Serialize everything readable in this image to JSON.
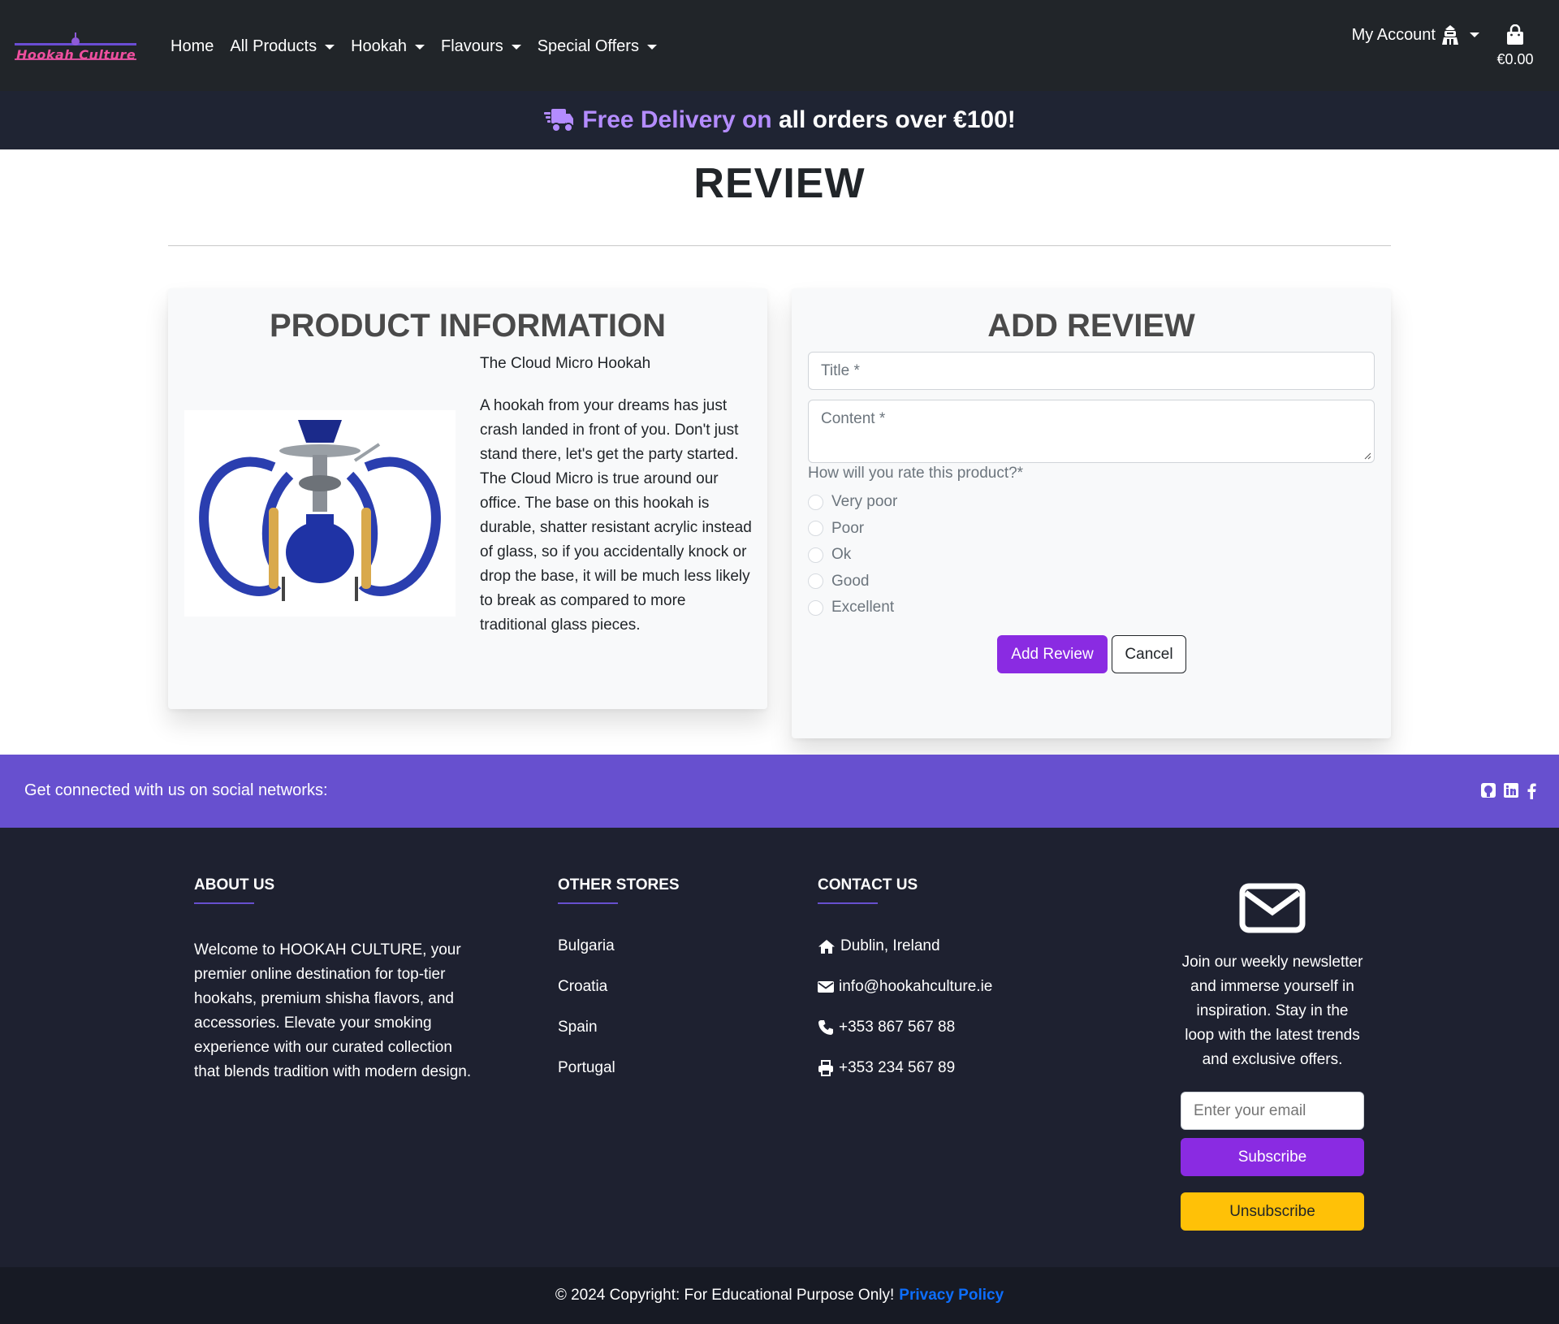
{
  "brand": {
    "logo_text": "Hookah Culture"
  },
  "nav": {
    "home": "Home",
    "all_products": "All Products",
    "hookah": "Hookah",
    "flavours": "Flavours",
    "special_offers": "Special Offers",
    "my_account": "My Account",
    "cart_total": "€0.00"
  },
  "banner": {
    "highlight": "Free Delivery on",
    "rest": "all orders over €100!"
  },
  "page": {
    "title": "REVIEW"
  },
  "product": {
    "heading": "PRODUCT INFORMATION",
    "name": "The Cloud Micro Hookah",
    "description": "A hookah from your dreams has just crash landed in front of you. Don't just stand there, let's get the party started. The Cloud Micro is true around our office. The base on this hookah is durable, shatter resistant acrylic instead of glass, so if you accidentally knock or drop the base, it will be much less likely to break as compared to more traditional glass pieces."
  },
  "review_form": {
    "heading": "ADD REVIEW",
    "title_placeholder": "Title *",
    "content_placeholder": "Content *",
    "rate_label": "How will you rate this product?*",
    "ratings": [
      "Very poor",
      "Poor",
      "Ok",
      "Good",
      "Excellent"
    ],
    "submit_label": "Add Review",
    "cancel_label": "Cancel"
  },
  "social": {
    "text": "Get connected with us on social networks:"
  },
  "footer": {
    "about_heading": "ABOUT US",
    "about_text": "Welcome to HOOKAH CULTURE, your premier online destination for top-tier hookahs, premium shisha flavors, and accessories. Elevate your smoking experience with our curated collection that blends tradition with modern design.",
    "stores_heading": "OTHER STORES",
    "stores": [
      "Bulgaria",
      "Croatia",
      "Spain",
      "Portugal"
    ],
    "contact_heading": "CONTACT US",
    "contact": {
      "address": "Dublin, Ireland",
      "email": "info@hookahculture.ie",
      "phone": "+353 867 567 88",
      "fax": "+353 234 567 89"
    },
    "newsletter_text": "Join our weekly newsletter and immerse yourself in inspiration. Stay in the loop with the latest trends and exclusive offers.",
    "email_placeholder": "Enter your email",
    "subscribe_label": "Subscribe",
    "unsubscribe_label": "Unsubscribe"
  },
  "copyright": {
    "text": "© 2024 Copyright: For Educational Purpose Only!",
    "link": "Privacy Policy"
  },
  "colors": {
    "accent": "#8a2be2",
    "social_bar": "#6750cf",
    "banner_highlight": "#b48cff",
    "warning": "#ffc107",
    "nav_bg": "#212529"
  }
}
